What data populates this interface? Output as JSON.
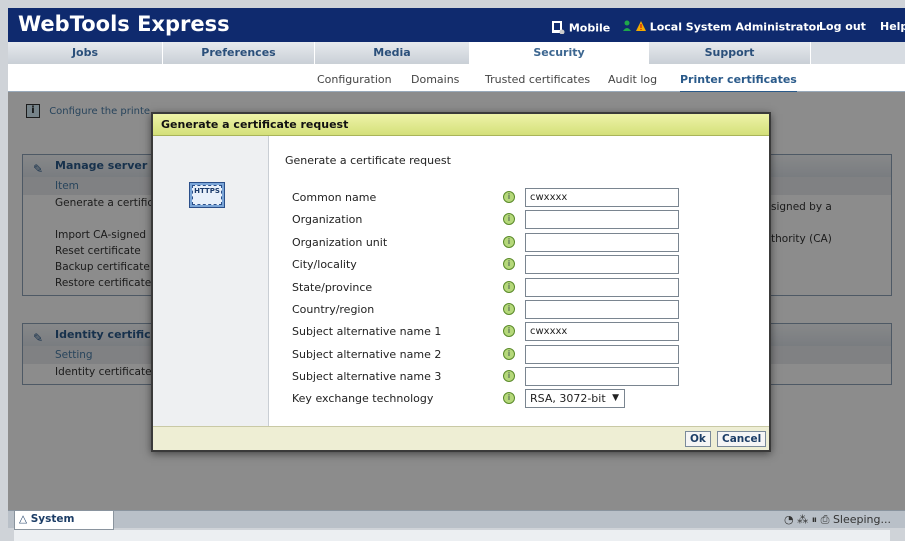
{
  "app_title": "WebTools Express",
  "header": {
    "mobile": "Mobile",
    "user": "Local System Administrator",
    "logout": "Log out",
    "help": "Help"
  },
  "tabs": [
    "Jobs",
    "Preferences",
    "Media",
    "Security",
    "Support"
  ],
  "active_tab": "Security",
  "subnav": [
    "Configuration",
    "Domains",
    "Trusted certificates",
    "Audit log",
    "Printer certificates"
  ],
  "active_subnav": "Printer certificates",
  "info_text": "Configure the printe",
  "manage_panel": {
    "title": "Manage server c",
    "column": "Item",
    "rows": [
      "Generate a certific",
      "",
      "Import CA-signed",
      "Reset certificate",
      "Backup certificate",
      "Restore certificate"
    ],
    "right_text_1": "signed by a",
    "right_text_2": "thority (CA)"
  },
  "identity_panel": {
    "title": "Identity certific",
    "column": "Setting",
    "rows": [
      "Identity certificate"
    ]
  },
  "dialog": {
    "title": "Generate a certificate request",
    "heading": "Generate a certificate request",
    "icon_text": "HTTPS",
    "fields": [
      {
        "label": "Common name",
        "value": "cwxxxx"
      },
      {
        "label": "Organization",
        "value": ""
      },
      {
        "label": "Organization unit",
        "value": ""
      },
      {
        "label": "City/locality",
        "value": ""
      },
      {
        "label": "State/province",
        "value": ""
      },
      {
        "label": "Country/region",
        "value": ""
      },
      {
        "label": "Subject alternative name 1",
        "value": "cwxxxx"
      },
      {
        "label": "Subject alternative name 2",
        "value": ""
      },
      {
        "label": "Subject alternative name 3",
        "value": ""
      }
    ],
    "key_exchange": {
      "label": "Key exchange technology",
      "value": "RSA, 3072-bit"
    },
    "ok": "Ok",
    "cancel": "Cancel"
  },
  "status": {
    "tab": "System",
    "state": "Sleeping..."
  }
}
